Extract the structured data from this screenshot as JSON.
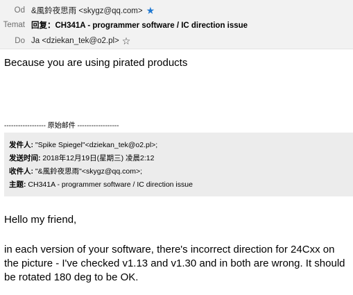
{
  "header": {
    "from_label": "Od",
    "from_value": "&風鈴夜思雨 <skygz@qq.com>",
    "subject_label": "Temat",
    "subject_value": "回复：CH341A - programmer software / IC direction issue",
    "to_label": "Do",
    "to_value": "Ja <dziekan_tek@o2.pl>",
    "from_star_icon": "star-filled-icon",
    "to_star_icon": "star-outline-icon",
    "star_color": "#1f78d1"
  },
  "reply": {
    "text": "Because you are using pirated products"
  },
  "original": {
    "divider": "------------------ 原始邮件 ------------------",
    "from_label": "发件人:",
    "from_value": " \"Spike Spiegel\"<dziekan_tek@o2.pl>;",
    "sent_label": "发送时间:",
    "sent_value": " 2018年12月19日(星期三) 凌晨2:12",
    "to_label": "收件人:",
    "to_value": " \"&風鈴夜思雨\"<skygz@qq.com>;",
    "subject_label": "主题:",
    "subject_value": " CH341A - programmer software / IC direction issue"
  },
  "message": {
    "greeting": "Hello my friend,",
    "paragraph": "in each version of your software, there's incorrect direction for 24Cxx on the picture - I've checked v1.13 and v1.30 and in both are wrong. It should be rotated 180 deg to be OK."
  }
}
